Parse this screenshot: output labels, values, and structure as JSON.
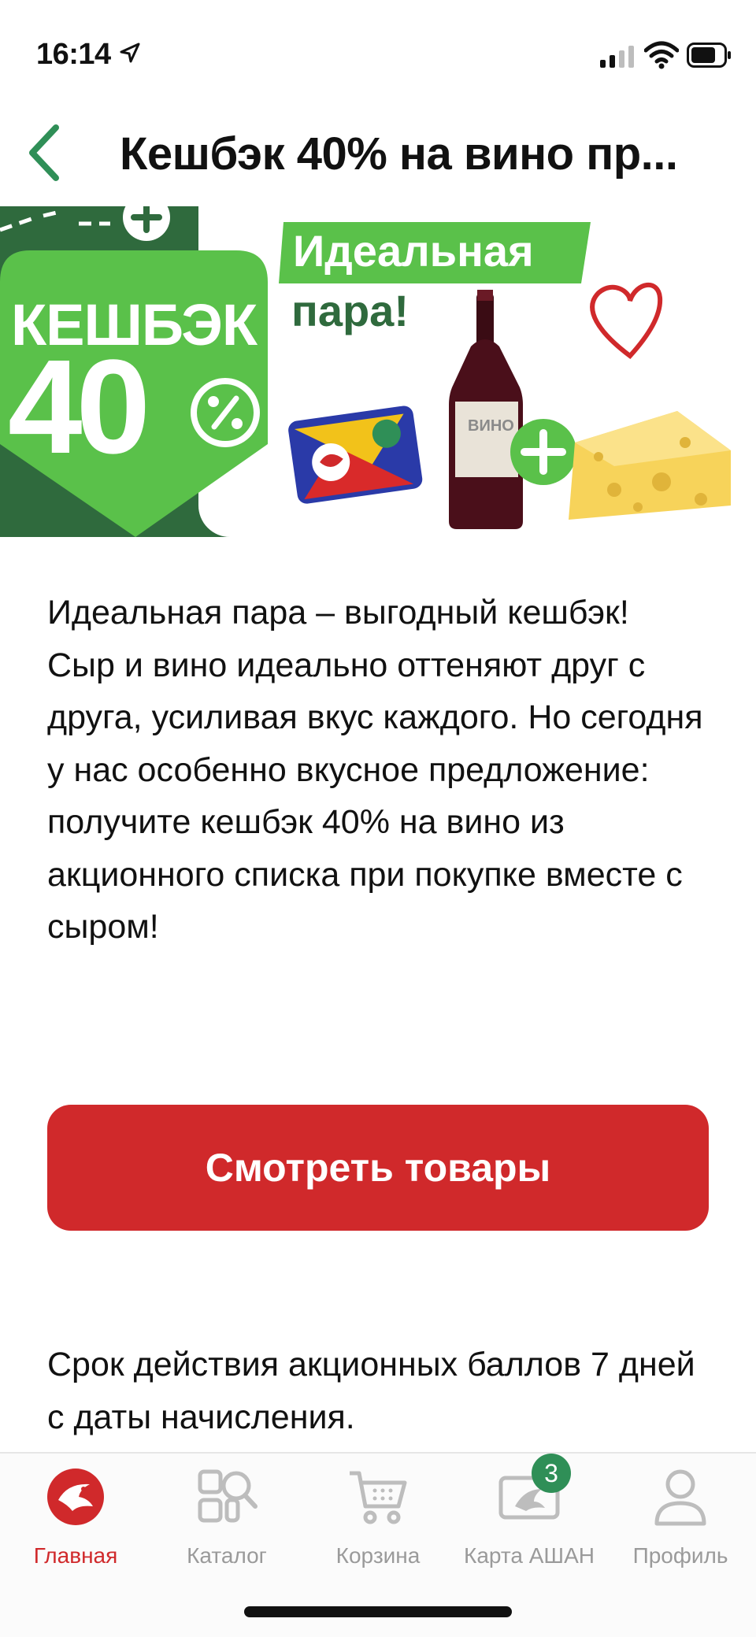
{
  "status": {
    "time": "16:14"
  },
  "header": {
    "title": "Кешбэк 40% на вино пр..."
  },
  "banner": {
    "cashback_label": "КЕШБЭК",
    "cashback_value": "40",
    "tagline_line1": "Идеальная",
    "tagline_line2": "пара!",
    "wine_label": "ВИНО"
  },
  "description": {
    "paragraph1": "Идеальная пара – выгодный кешбэк!",
    "paragraph2": "Сыр и вино идеально оттеняют друг с друга, усиливая вкус каждого. Но сегодня у нас особенно вкусное предложение: получите кешбэк 40% на вино из акционного списка при покупке вместе с сыром!"
  },
  "cta": {
    "label": "Смотреть товары"
  },
  "validity": {
    "text": "Срок действия акционных баллов 7 дней с даты начисления."
  },
  "tabs": [
    {
      "label": "Главная",
      "icon": "home-bird-icon",
      "active": true
    },
    {
      "label": "Каталог",
      "icon": "catalog-search-icon"
    },
    {
      "label": "Корзина",
      "icon": "cart-icon"
    },
    {
      "label": "Карта АШАН",
      "icon": "loyalty-card-icon",
      "badge": "3"
    },
    {
      "label": "Профиль",
      "icon": "profile-icon"
    }
  ],
  "colors": {
    "accent_red": "#d0292b",
    "brand_green": "#5ac14a",
    "dark_green": "#2f6a3d",
    "badge_green": "#2f8f57",
    "tab_inactive": "#9a9a9a"
  }
}
